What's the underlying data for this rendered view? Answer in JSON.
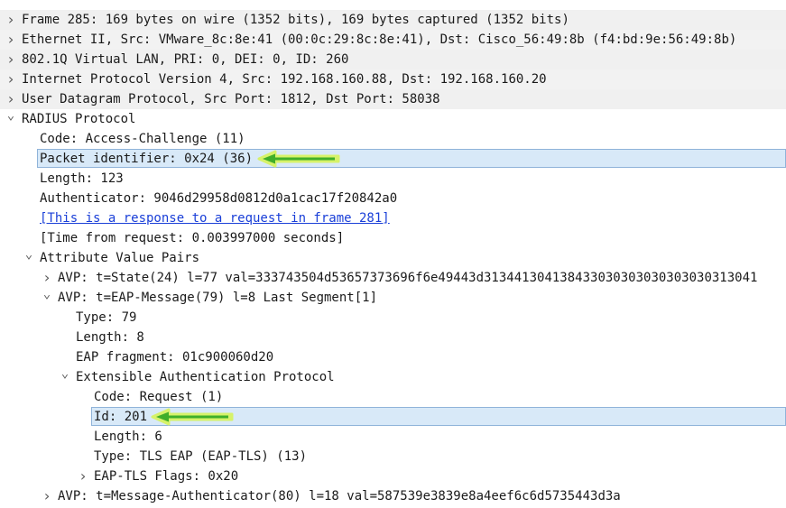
{
  "tree": [
    {
      "text": "Frame 285: 169 bytes on wire (1352 bits), 169 bytes captured (1352 bits)",
      "level": 0,
      "expander": "collapsed"
    },
    {
      "text": "Ethernet II, Src: VMware_8c:8e:41 (00:0c:29:8c:8e:41), Dst: Cisco_56:49:8b (f4:bd:9e:56:49:8b)",
      "level": 0,
      "expander": "collapsed"
    },
    {
      "text": "802.1Q Virtual LAN, PRI: 0, DEI: 0, ID: 260",
      "level": 0,
      "expander": "collapsed"
    },
    {
      "text": "Internet Protocol Version 4, Src: 192.168.160.88, Dst: 192.168.160.20",
      "level": 0,
      "expander": "collapsed"
    },
    {
      "text": "User Datagram Protocol, Src Port: 1812, Dst Port: 58038",
      "level": 0,
      "expander": "collapsed"
    },
    {
      "text": "RADIUS Protocol",
      "level": 0,
      "expander": "expanded"
    },
    {
      "text": "Code: Access-Challenge (11)",
      "level": 1,
      "expander": "none"
    },
    {
      "text": "Packet identifier: 0x24 (36)",
      "level": 1,
      "expander": "none",
      "highlight": true
    },
    {
      "text": "Length: 123",
      "level": 1,
      "expander": "none"
    },
    {
      "text": "Authenticator: 9046d29958d0812d0a1cac17f20842a0",
      "level": 1,
      "expander": "none"
    },
    {
      "text": "[This is a response to a request in frame 281]",
      "level": 1,
      "expander": "none",
      "link": true
    },
    {
      "text": "[Time from request: 0.003997000 seconds]",
      "level": 1,
      "expander": "none"
    },
    {
      "text": "Attribute Value Pairs",
      "level": 1,
      "expander": "expanded"
    },
    {
      "text": "AVP: t=State(24) l=77 val=333743504d53657373696f6e49443d313441304138433030303030303030313041",
      "level": 2,
      "expander": "collapsed"
    },
    {
      "text": "AVP: t=EAP-Message(79) l=8 Last Segment[1]",
      "level": 2,
      "expander": "expanded"
    },
    {
      "text": "Type: 79",
      "level": 3,
      "expander": "none"
    },
    {
      "text": "Length: 8",
      "level": 3,
      "expander": "none"
    },
    {
      "text": "EAP fragment: 01c900060d20",
      "level": 3,
      "expander": "none"
    },
    {
      "text": "Extensible Authentication Protocol",
      "level": 3,
      "expander": "expanded"
    },
    {
      "text": "Code: Request (1)",
      "level": 4,
      "expander": "none"
    },
    {
      "text": "Id: 201",
      "level": 4,
      "expander": "none",
      "highlight": true
    },
    {
      "text": "Length: 6",
      "level": 4,
      "expander": "none"
    },
    {
      "text": "Type: TLS EAP (EAP-TLS) (13)",
      "level": 4,
      "expander": "none"
    },
    {
      "text": "EAP-TLS Flags: 0x20",
      "level": 4,
      "expander": "collapsed"
    },
    {
      "text": "AVP: t=Message-Authenticator(80) l=18 val=587539e3839e8a4eef6c6d5735443d3a",
      "level": 2,
      "expander": "collapsed"
    }
  ],
  "colors": {
    "header_bg": "#f0f0f0",
    "alt_bg": "#f2f2f2",
    "highlight_bg": "#d8e9f8",
    "highlight_border": "#8fb3d9",
    "link": "#1a3fd8",
    "arrow_green": "#3fae2a",
    "arrow_glow": "#d6f26a"
  },
  "icons": {
    "collapsed": "chevron-right-icon",
    "expanded": "chevron-down-icon",
    "annotation": "green-arrow-icon"
  }
}
